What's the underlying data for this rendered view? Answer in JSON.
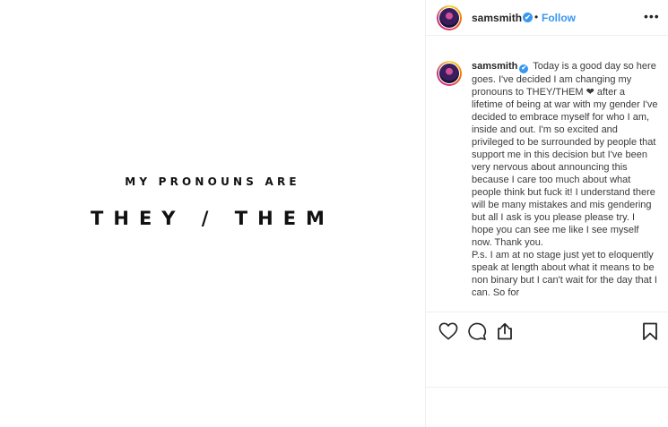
{
  "image": {
    "line1": "MY PRONOUNS ARE",
    "line2": "THEY / THEM"
  },
  "header": {
    "username": "samsmith",
    "verified_icon": "✔",
    "separator": "•",
    "follow_label": "Follow",
    "more_icon": "•••"
  },
  "caption": {
    "username": "samsmith",
    "text": "Today is a good day so here goes. I've decided I am changing my pronouns to THEY/THEM ❤ after a lifetime of being at war with my gender I've decided to embrace myself for who I am, inside and out. I'm so excited and privileged to be surrounded by people that support me in this decision but I've been very nervous about announcing this because I care too much about what people think but fuck it! I understand there will be many mistakes and mis gendering but all I ask is you please please try. I hope you can see me like I see myself now. Thank you.\nP.s. I am at no stage just yet to eloquently speak at length about what it means to be non binary but I can't wait for the day that I can. So for"
  },
  "actions": {
    "icons": [
      "heart-icon",
      "comment-icon",
      "share-icon",
      "bookmark-icon"
    ]
  }
}
